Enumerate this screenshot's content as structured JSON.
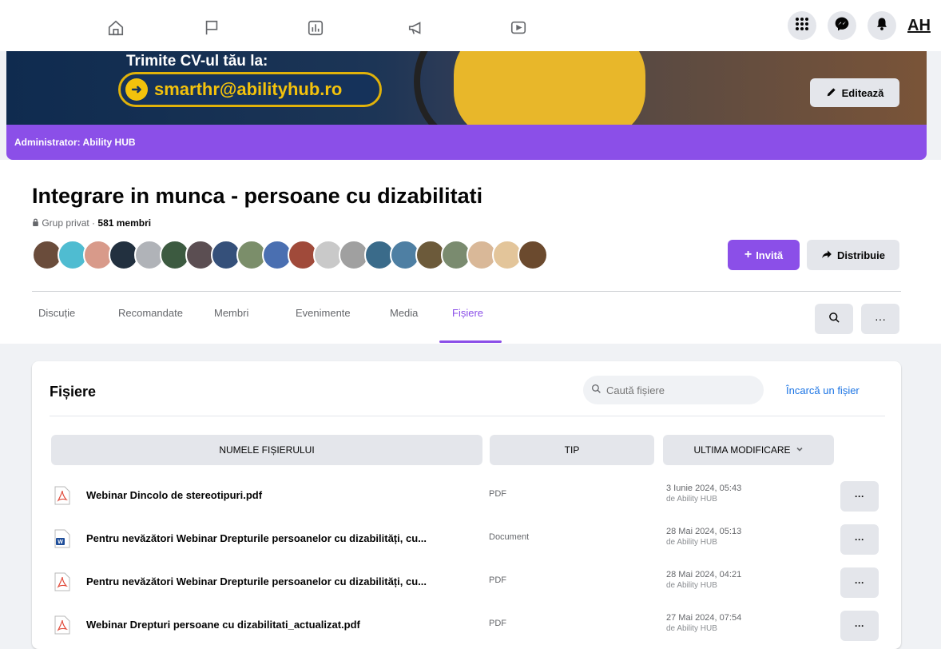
{
  "header": {
    "nav_icons": [
      "home-icon",
      "flag-icon",
      "dashboard-icon",
      "megaphone-icon",
      "video-icon"
    ],
    "right_buttons": [
      "menu-grid-icon",
      "messenger-icon",
      "bell-icon"
    ],
    "brand": "AH"
  },
  "cover": {
    "headline": "Trimite CV-ul tău la:",
    "email": "smarthr@abilityhub.ro",
    "edit_label": "Editează"
  },
  "admin": {
    "label": "Administrator: Ability HUB"
  },
  "group": {
    "title": "Integrare in munca - persoane cu dizabilitati",
    "privacy": "Grup privat",
    "members": "581 membri",
    "invite_label": "Invită",
    "share_label": "Distribuie",
    "avatar_colors": [
      "#6a4c3b",
      "#4fbcd1",
      "#d89a8a",
      "#22303f",
      "#b0b3b8",
      "#3c5a40",
      "#5b4e52",
      "#35507a",
      "#7b8e6a",
      "#4a6fb1",
      "#a04a3a",
      "#c9c9c9",
      "#a0a0a0",
      "#3a6b8a",
      "#4e7fa3",
      "#6c5a3a",
      "#7a8b6f",
      "#d9b898",
      "#e3c59a",
      "#6b4a2e"
    ]
  },
  "tabs": [
    {
      "label": "Discuție",
      "active": false
    },
    {
      "label": "Recomandate",
      "active": false
    },
    {
      "label": "Membri",
      "active": false
    },
    {
      "label": "Evenimente",
      "active": false
    },
    {
      "label": "Media",
      "active": false
    },
    {
      "label": "Fișiere",
      "active": true
    }
  ],
  "files": {
    "title": "Fișiere",
    "search_placeholder": "Caută fișiere",
    "upload_label": "Încarcă un fișier",
    "columns": {
      "name": "NUMELE FIȘIERULUI",
      "type": "TIP",
      "modified": "ULTIMA MODIFICARE"
    },
    "rows": [
      {
        "name": "Webinar Dincolo de stereotipuri.pdf",
        "type": "PDF",
        "date": "3 Iunie 2024, 05:43",
        "by": "de Ability HUB",
        "icon": "pdf-file-icon"
      },
      {
        "name": "Pentru nevăzători Webinar Drepturile persoanelor cu dizabilități, cu...",
        "type": "Document",
        "date": "28 Mai 2024, 05:13",
        "by": "de Ability HUB",
        "icon": "word-file-icon"
      },
      {
        "name": "Pentru nevăzători Webinar Drepturile persoanelor cu dizabilități, cu...",
        "type": "PDF",
        "date": "28 Mai 2024, 04:21",
        "by": "de Ability HUB",
        "icon": "pdf-file-icon"
      },
      {
        "name": "Webinar Drepturi persoane cu dizabilitati_actualizat.pdf",
        "type": "PDF",
        "date": "27 Mai 2024, 07:54",
        "by": "de Ability HUB",
        "icon": "pdf-file-icon"
      }
    ]
  },
  "colors": {
    "accent": "#8b4fe8",
    "link": "#1b74e4"
  }
}
